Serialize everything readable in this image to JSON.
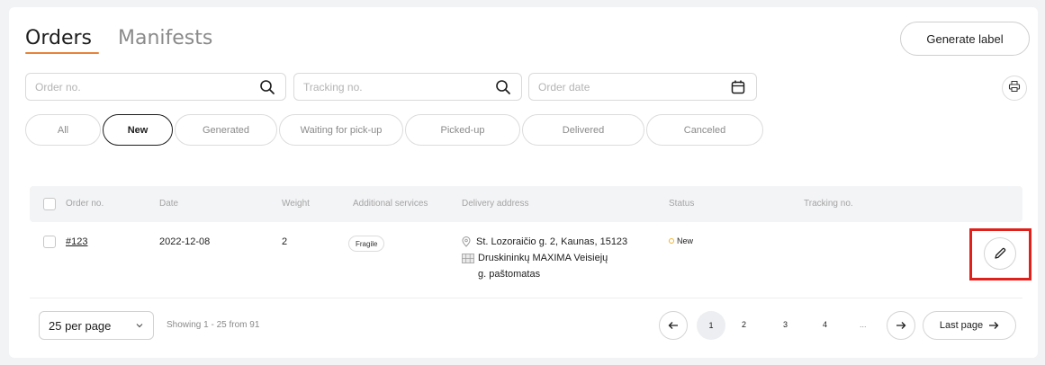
{
  "tabs": {
    "orders": "Orders",
    "manifests": "Manifests"
  },
  "actions": {
    "generate_label": "Generate label"
  },
  "search": {
    "order_placeholder": "Order no.",
    "tracking_placeholder": "Tracking no.",
    "date_placeholder": "Order date"
  },
  "filters": [
    "All",
    "New",
    "Generated",
    "Waiting for pick-up",
    "Picked-up",
    "Delivered",
    "Canceled"
  ],
  "active_filter": "New",
  "table": {
    "headers": [
      "Order no.",
      "Date",
      "Weight",
      "Additional services",
      "Delivery address",
      "Status",
      "Tracking no."
    ],
    "rows": [
      {
        "order_no": "#123",
        "date": "2022-12-08",
        "weight": "2",
        "service": "Fragile",
        "address_line": "St. Lozoraičio g. 2, Kaunas, 15123",
        "terminal_line1": "Druskininkų MAXIMA Veisiejų",
        "terminal_line2": "g. paštomatas",
        "status": "New",
        "tracking_no": ""
      }
    ]
  },
  "pagination": {
    "per_page": "25 per page",
    "showing": "Showing 1 - 25 from 91",
    "pages": [
      "1",
      "2",
      "3",
      "4",
      "..."
    ],
    "current": "1",
    "last_page": "Last page"
  },
  "colors": {
    "accent": "#e8833a",
    "highlight": "#e0201b",
    "status_new": "#f0b429"
  },
  "icons": [
    "search-icon",
    "calendar-icon",
    "print-icon",
    "pin-icon",
    "parcel-terminal-icon",
    "edit-icon",
    "chevron-down-icon",
    "arrow-left-icon",
    "arrow-right-icon"
  ]
}
